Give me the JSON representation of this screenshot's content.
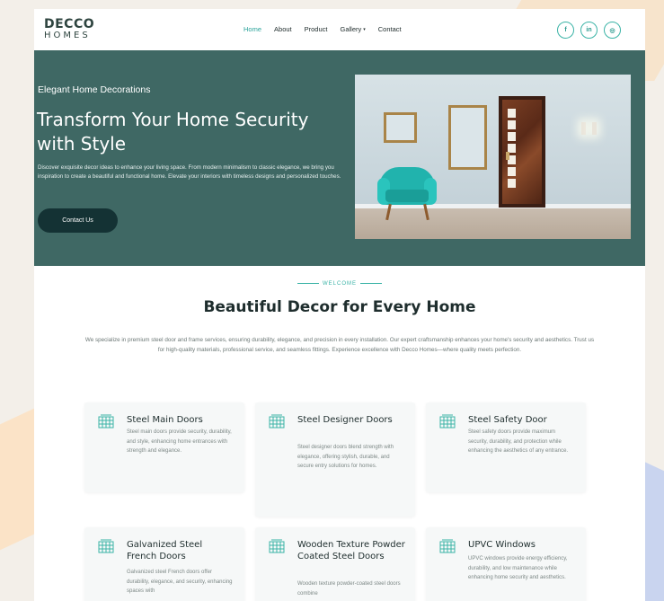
{
  "brand": {
    "line1": "DECCO",
    "line2": "HOMES"
  },
  "nav": {
    "items": [
      {
        "label": "Home",
        "active": true
      },
      {
        "label": "About",
        "active": false
      },
      {
        "label": "Product",
        "active": false
      },
      {
        "label": "Gallery",
        "active": false,
        "has_dropdown": true
      },
      {
        "label": "Contact",
        "active": false
      }
    ],
    "socials": [
      {
        "icon": "facebook-icon",
        "glyph": "f"
      },
      {
        "icon": "linkedin-icon",
        "glyph": "in"
      },
      {
        "icon": "instagram-icon",
        "glyph": "◎"
      }
    ]
  },
  "hero": {
    "kicker": "Elegant Home Decorations",
    "title": "Transform Your Home Security with Style",
    "description": "Discover exquisite decor ideas to enhance your living space. From modern minimalism to classic elegance, we bring you inspiration to create a beautiful and functional home. Elevate your interiors with timeless designs and personalized touches.",
    "button_label": "Contact Us"
  },
  "welcome": {
    "kicker": "WELCOME",
    "title": "Beautiful Decor for Every Home",
    "description": "We specialize in premium steel door and frame services, ensuring durability, elegance, and precision in every installation. Our expert craftsmanship enhances your home's security and aesthetics. Trust us for high-quality materials, professional service, and seamless fittings. Experience excellence with Decco Homes—where quality meets perfection."
  },
  "services": [
    {
      "title": "Steel Main Doors",
      "text": "Steel main doors provide security, durability, and style, enhancing home entrances with strength and elegance."
    },
    {
      "title": "Steel Designer Doors",
      "text": "Steel designer doors blend strength with elegance, offering stylish, durable, and secure entry solutions for homes."
    },
    {
      "title": "Steel Safety Door",
      "text": "Steel safety doors provide maximum security, durability, and protection while enhancing the aesthetics of any entrance."
    },
    {
      "title": "Galvanized Steel French Doors",
      "text": "Galvanized steel French doors offer durability, elegance, and security, enhancing spaces with"
    },
    {
      "title": "Wooden Texture Powder Coated Steel Doors",
      "text": "Wooden texture powder-coated steel doors combine"
    },
    {
      "title": "UPVC Windows",
      "text": "UPVC windows provide energy efficiency, durability, and low maintenance while enhancing home security and aesthetics."
    }
  ],
  "colors": {
    "accent": "#3ab3a6",
    "hero_bg": "#3f6864",
    "button_bg": "#143234"
  }
}
